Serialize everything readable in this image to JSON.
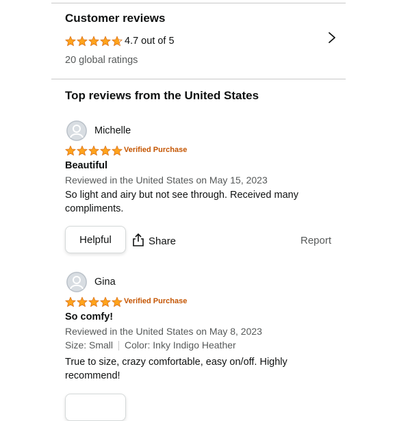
{
  "summary": {
    "title": "Customer reviews",
    "rating_text": "4.7 out of 5",
    "rating_value": 4.7,
    "global_ratings": "20 global ratings"
  },
  "top_reviews_heading": "Top reviews from the United States",
  "reviews": [
    {
      "author": "Michelle",
      "stars": 5,
      "badge": "Verified Purchase",
      "title": "Beautiful",
      "meta": "Reviewed in the United States on May 15, 2023",
      "body": "So light and airy but not see through. Received many compliments."
    },
    {
      "author": "Gina",
      "stars": 5,
      "badge": "Verified Purchase",
      "title": "So comfy!",
      "meta": "Reviewed in the United States on May 8, 2023",
      "size": "Size: Small",
      "color": "Color: Inky Indigo Heather",
      "body": "True to size, crazy comfortable, easy on/off. Highly recommend!"
    }
  ],
  "actions": {
    "helpful": "Helpful",
    "share": "Share",
    "report": "Report"
  },
  "colors": {
    "star": "#ffa41c",
    "star_outline": "#de7921",
    "verified": "#c45500"
  },
  "icons": [
    "chevron-right-icon",
    "star-icon",
    "share-icon",
    "avatar-icon"
  ]
}
